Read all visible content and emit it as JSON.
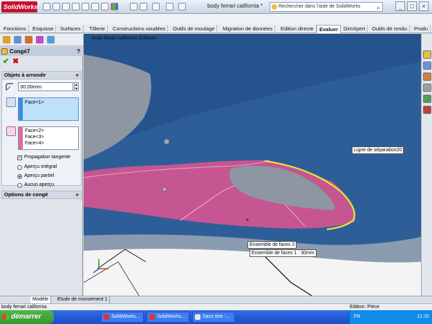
{
  "app": {
    "logo_text": "SolidWorks",
    "doc_title": "body ferrari california *",
    "search_placeholder": "Rechercher dans l'aide de SolidWorks",
    "win_buttons": [
      "_",
      "□",
      "×"
    ]
  },
  "command_tabs": [
    {
      "label": "Fonctions",
      "active": false
    },
    {
      "label": "Esquisse",
      "active": false
    },
    {
      "label": "Surfaces",
      "active": false
    },
    {
      "label": "Tôlerie",
      "active": false
    },
    {
      "label": "Constructions soudées",
      "active": false
    },
    {
      "label": "Outils de moulage",
      "active": false
    },
    {
      "label": "Migration de données",
      "active": false
    },
    {
      "label": "Edition directe",
      "active": false
    },
    {
      "label": "Evaluer",
      "active": true
    },
    {
      "label": "DimXpert",
      "active": false
    },
    {
      "label": "Outils de rendu",
      "active": false
    },
    {
      "label": "Produ",
      "active": false
    }
  ],
  "property_manager": {
    "title": "Congé7",
    "help": "?",
    "ok": "✔",
    "cancel": "✖",
    "items_section": {
      "title": "Objets à arrondir",
      "radius": "30.00mm",
      "selection1": [
        "Face<1>"
      ],
      "selection2": [
        "Face<2>",
        "Face<3>",
        "Face<4>"
      ],
      "tangent_propagation": "Propagation tangente",
      "preview_options": [
        {
          "label": "Aperçu intégral",
          "selected": false
        },
        {
          "label": "Aperçu partiel",
          "selected": true
        },
        {
          "label": "Aucun aperçu",
          "selected": false
        }
      ]
    },
    "options_section": {
      "title": "Options de congé"
    }
  },
  "viewport": {
    "tree_label": "body ferrari california  (Défaut<",
    "callouts": {
      "separation_line": "Ligne de séparation20",
      "face_set_2": "Ensemble de faces 2",
      "face_set_1": "Ensemble de faces 1 : 30mm"
    }
  },
  "bottom_tabs": [
    {
      "label": "Modèle",
      "active": true
    },
    {
      "label": "Etude de mouvement 1",
      "active": false
    }
  ],
  "statusbar": {
    "left": "body ferrari california",
    "right": "Edition: Pièce"
  },
  "taskbar": {
    "start": "démarrer",
    "buttons": [
      "SolidWorks...",
      "SolidWorks...",
      "Sans titre -..."
    ],
    "lang": "FR",
    "clock": "21:32"
  },
  "colors": {
    "viewport_blue": "#2a5c99",
    "fillet_pink": "#c94e8e",
    "highlight_yellow": "#e8e23a"
  }
}
